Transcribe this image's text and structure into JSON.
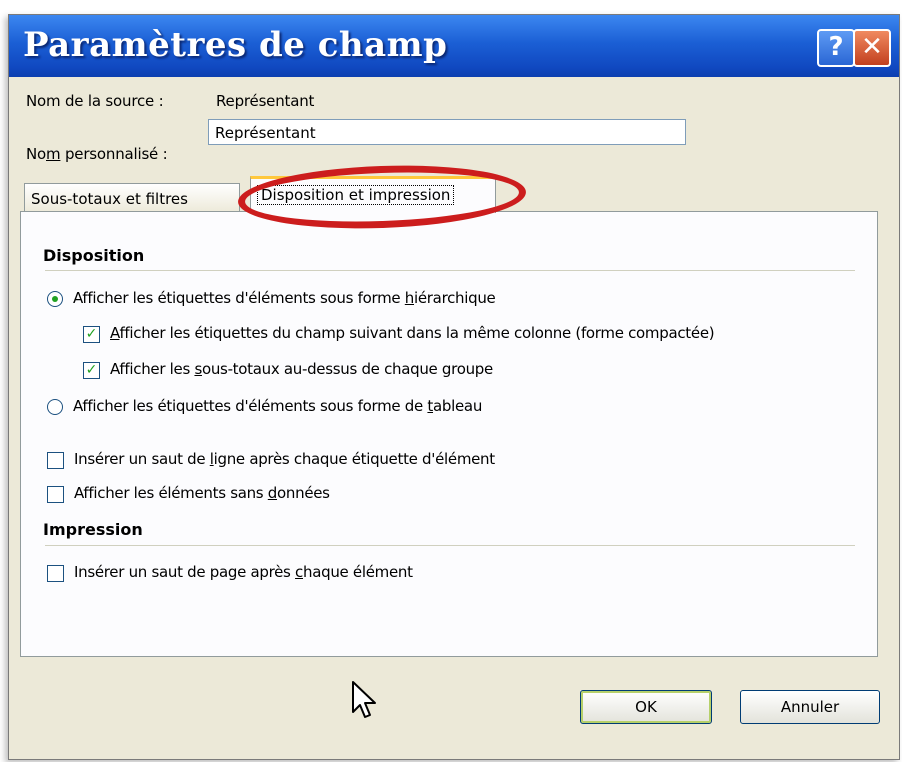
{
  "dialog": {
    "title": "Paramètres de champ",
    "help_icon": "?",
    "close_icon": "✕",
    "source_label": "Nom de la source :",
    "source_value": "Représentant",
    "custom_label_prefix": "No",
    "custom_label_accel": "m",
    "custom_label_suffix": " personnalisé :",
    "custom_value": "Représentant"
  },
  "tabs": [
    {
      "label": "Sous-totaux et filtres",
      "active": false
    },
    {
      "label": "Disposition et impression",
      "active": true
    }
  ],
  "layout": {
    "heading": "Disposition",
    "radio_hier": {
      "pre": "Afficher les étiquettes d'éléments sous forme ",
      "accel": "h",
      "post": "iérarchique",
      "checked": true
    },
    "chk_compact": {
      "pre": "",
      "accel": "A",
      "post": "fficher les étiquettes du champ suivant dans la même colonne (forme compactée)",
      "checked": true
    },
    "chk_subtotals": {
      "pre": "Afficher les ",
      "accel": "s",
      "post": "ous-totaux au-dessus de chaque groupe",
      "checked": true
    },
    "radio_table": {
      "pre": "Afficher les étiquettes d'éléments sous forme de ",
      "accel": "t",
      "post": "ableau",
      "checked": false
    },
    "chk_line_break": {
      "pre": "Insérer un saut de ",
      "accel": "l",
      "post": "igne après chaque étiquette d'élément",
      "checked": false
    },
    "chk_no_data": {
      "pre": "Afficher les éléments sans ",
      "accel": "d",
      "post": "onnées",
      "checked": false
    }
  },
  "print": {
    "heading": "Impression",
    "chk_page_break": {
      "pre": "Insérer un saut de page après ",
      "accel": "c",
      "post": "haque élément",
      "checked": false
    }
  },
  "buttons": {
    "ok": "OK",
    "cancel": "Annuler"
  },
  "icons": {
    "check": "✓"
  },
  "colors": {
    "title_bar": "#1b5fd5",
    "annotation_oval": "#cc1d1d",
    "check_green": "#21a121"
  }
}
